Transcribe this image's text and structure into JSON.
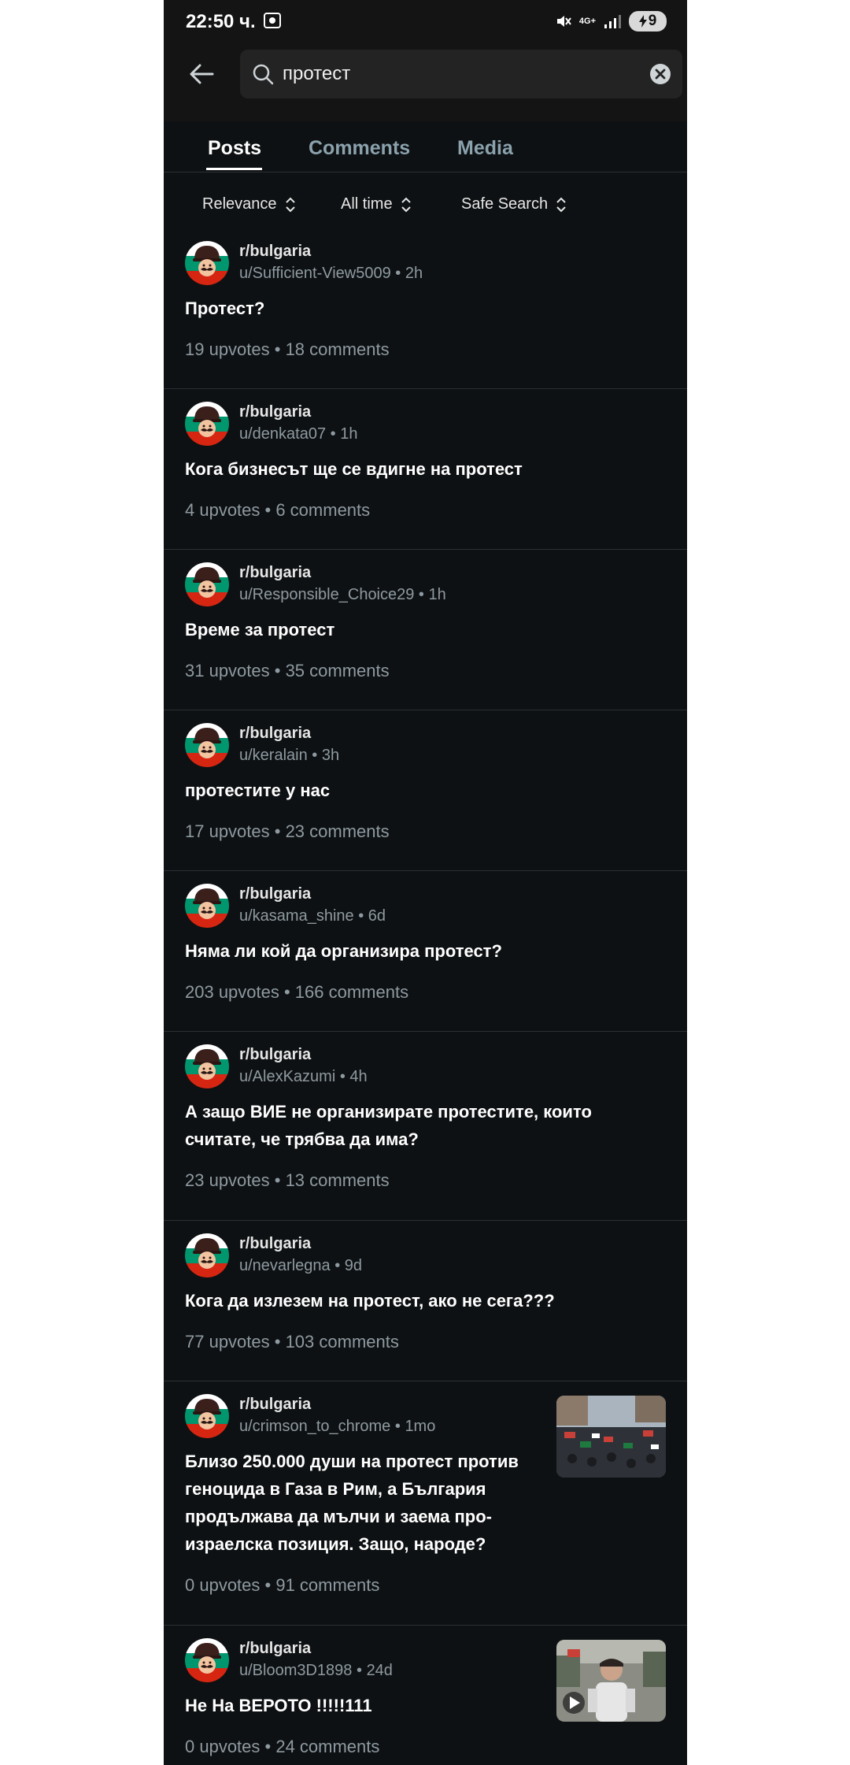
{
  "status_bar": {
    "time": "22:50 ч.",
    "network": "4G+",
    "battery": "9"
  },
  "search": {
    "query": "протест"
  },
  "tabs": [
    "Posts",
    "Comments",
    "Media"
  ],
  "filters": {
    "sort": "Relevance",
    "time": "All time",
    "safe": "Safe Search"
  },
  "posts": [
    {
      "subreddit": "r/bulgaria",
      "author": "u/Sufficient-View5009",
      "age": "2h",
      "title": "Протест?",
      "stats": "19 upvotes • 18 comments"
    },
    {
      "subreddit": "r/bulgaria",
      "author": "u/denkata07",
      "age": "1h",
      "title": "Кога бизнесът ще се вдигне на протест",
      "stats": "4 upvotes • 6 comments"
    },
    {
      "subreddit": "r/bulgaria",
      "author": "u/Responsible_Choice29",
      "age": "1h",
      "title": "Време за протест",
      "stats": "31 upvotes • 35 comments"
    },
    {
      "subreddit": "r/bulgaria",
      "author": "u/keralain",
      "age": "3h",
      "title": "протестите у нас",
      "stats": "17 upvotes • 23 comments"
    },
    {
      "subreddit": "r/bulgaria",
      "author": "u/kasama_shine",
      "age": "6d",
      "title": "Няма ли кой да организира протест?",
      "stats": "203 upvotes • 166 comments"
    },
    {
      "subreddit": "r/bulgaria",
      "author": "u/AlexKazumi",
      "age": "4h",
      "title": "А защо ВИЕ не организирате протестите, които считате, че трябва да има?",
      "stats": "23 upvotes • 13 comments"
    },
    {
      "subreddit": "r/bulgaria",
      "author": "u/nevarlegna",
      "age": "9d",
      "title": "Кога да излезем на протест, ако не сега???",
      "stats": "77 upvotes • 103 comments"
    },
    {
      "subreddit": "r/bulgaria",
      "author": "u/crimson_to_chrome",
      "age": "1mo",
      "title": "Близо 250.000 души на протест против геноцида в Газа в Рим, а България продължава да мълчи и заема про-израелска позиция. Защо, народе?",
      "stats": "0 upvotes • 91 comments"
    },
    {
      "subreddit": "r/bulgaria",
      "author": "u/Bloom3D1898",
      "age": "24d",
      "title": "Не На ВЕРОТО !!!!!111",
      "stats": "0 upvotes • 24 comments"
    }
  ],
  "colors": {
    "background": "#0e1113",
    "muted": "#8e9aa1",
    "divider": "#2b3034"
  }
}
